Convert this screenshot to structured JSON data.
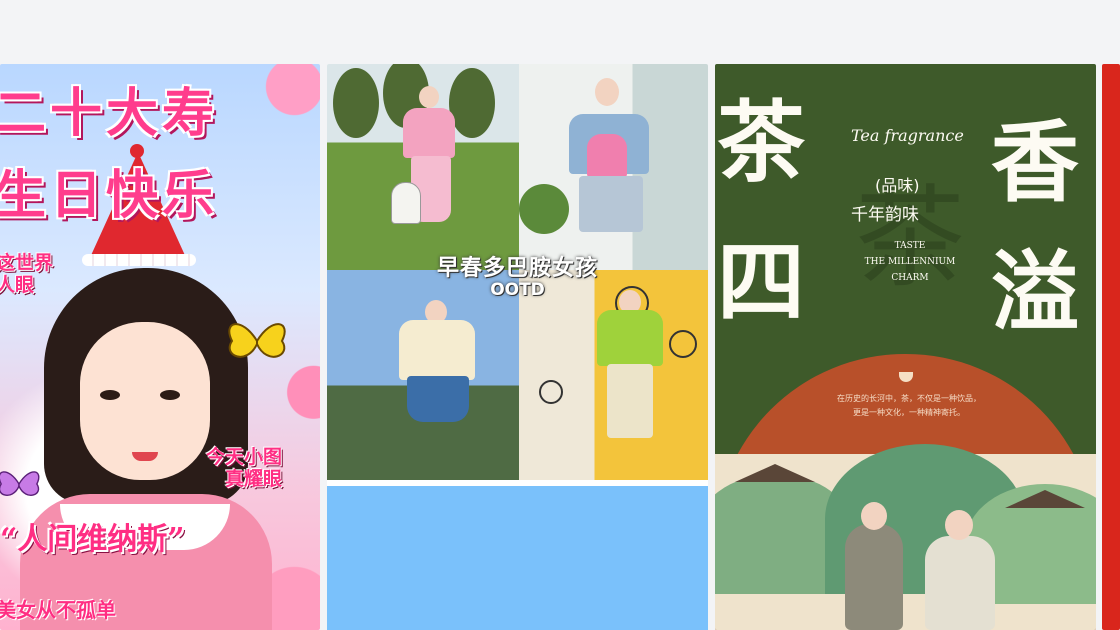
{
  "feed": {
    "cards": [
      {
        "id": "birthday",
        "title_line1": "二十大寿",
        "title_line2": "生日快乐",
        "side_left_1": "这世界",
        "side_left_2": "人眼",
        "side_right_1": "今天小图",
        "side_right_2": "真耀眼",
        "quote": "“人间维纳斯”",
        "bottom_text": "美女从不孤单"
      },
      {
        "id": "ootd",
        "title": "早春多巴胺女孩",
        "subtitle": "OOTD"
      },
      {
        "id": "tea",
        "big_left_1": "茶",
        "big_left_2": "四",
        "big_right_1": "香",
        "big_right_2": "溢",
        "english": "Tea fragrance",
        "watermark": "茶",
        "pin": "(品味)",
        "qian": "千年韵味",
        "taste_1": "TASTE",
        "taste_2": "THE MILLENNIUM",
        "taste_3": "CHARM",
        "body_1": "在历史的长河中，茶，不仅是一种饮品，",
        "body_2": "更是一种文化，一种精神寄托。"
      }
    ]
  },
  "colors": {
    "page_bg": "#f3f4f6",
    "pink_accent": "#ff3d8d",
    "tea_green": "#3e5a2a",
    "tea_orange": "#b8502a",
    "light_blue_tile": "#7ac1fb"
  }
}
